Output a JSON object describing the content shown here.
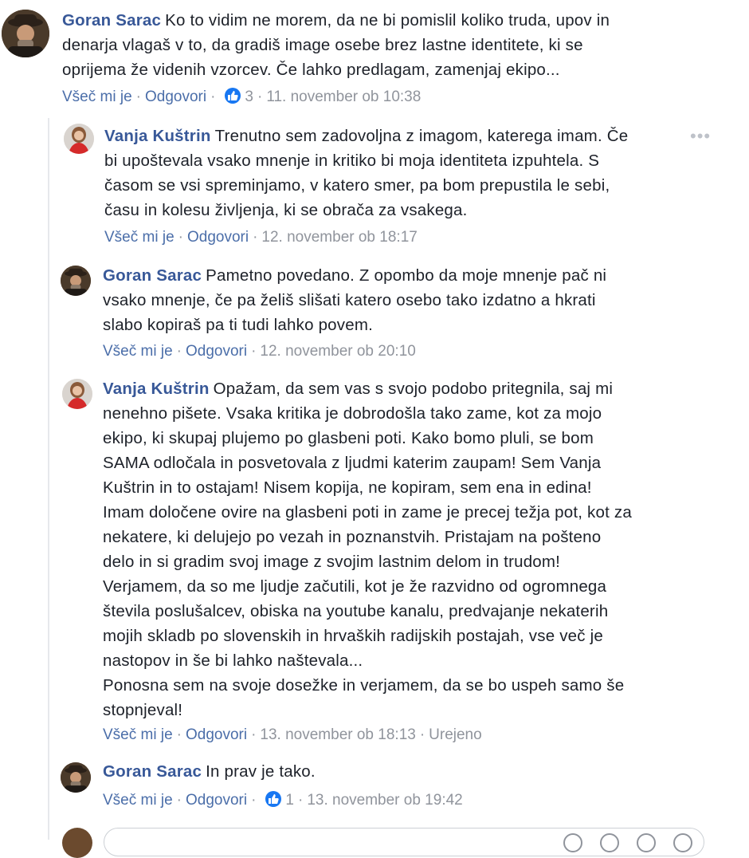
{
  "comments": [
    {
      "author": "Goran Sarac",
      "text": "Ko to vidim ne morem, da ne bi pomislil koliko truda, upov in\ndenarja vlagaš v to, da gradiš image osebe brez lastne identitete, ki se\noprijema že videnih vzorcev. Če lahko predlagam, zamenjaj ekipo...",
      "like_label": "Všeč mi je",
      "reply_label": "Odgovori",
      "reaction_count": "3",
      "timestamp": "11. november ob 10:38"
    },
    {
      "author": "Vanja Kuštrin",
      "text": "Trenutno sem zadovoljna z imagom, katerega imam. Če\nbi upoštevala vsako mnenje in kritiko bi moja identiteta izpuhtela. S\nčasom se vsi spreminjamo, v katero smer, pa bom prepustila le sebi,\nčasu in kolesu življenja, ki se obrača za vsakega.",
      "like_label": "Všeč mi je",
      "reply_label": "Odgovori",
      "timestamp": "12. november ob 18:17"
    },
    {
      "author": "Goran Sarac",
      "text": "Pametno povedano. Z opombo da moje mnenje pač ni\nvsako mnenje, če pa želiš slišati katero osebo tako izdatno a hkrati\nslabo kopiraš pa ti tudi lahko povem.",
      "like_label": "Všeč mi je",
      "reply_label": "Odgovori",
      "timestamp": "12. november ob 20:10"
    },
    {
      "author": "Vanja Kuštrin",
      "text": "Opažam, da sem vas s svojo podobo pritegnila, saj mi\nnenehno pišete. Vsaka kritika je dobrodošla tako zame, kot za mojo\nekipo, ki skupaj plujemo po glasbeni poti. Kako bomo pluli, se bom\nSAMA odločala in posvetovala z ljudmi katerim zaupam! Sem Vanja\nKuštrin in to ostajam! Nisem kopija, ne kopiram, sem ena in edina!\nImam določene ovire na glasbeni poti in zame je precej težja pot, kot za\nnekatere, ki delujejo po vezah in poznanstvih. Pristajam na pošteno\ndelo in si gradim svoj image z svojim lastnim delom in trudom!\nVerjamem, da so me ljudje začutili, kot je že razvidno od ogromnega\nštevila poslušalcev, obiska na youtube kanalu, predvajanje nekaterih\nmojih skladb po slovenskih in hrvaških radijskih postajah, vse več je\nnastopov in še bi lahko naštevala...\nPonosna sem na svoje dosežke in verjamem, da se bo uspeh samo še\nstopnjeval!",
      "like_label": "Všeč mi je",
      "reply_label": "Odgovori",
      "timestamp": "13. november ob 18:13",
      "edited_label": "Urejeno"
    },
    {
      "author": "Goran Sarac",
      "text": "In prav je tako.",
      "like_label": "Všeč mi je",
      "reply_label": "Odgovori",
      "reaction_count": "1",
      "timestamp": "13. november ob 19:42"
    }
  ],
  "colors": {
    "author": "#385898",
    "action": "#4b6ea9",
    "meta": "#90949c",
    "like_badge": "#1877f2"
  },
  "icons": {
    "options": "more-options-icon",
    "reaction": "like-reaction-icon"
  }
}
